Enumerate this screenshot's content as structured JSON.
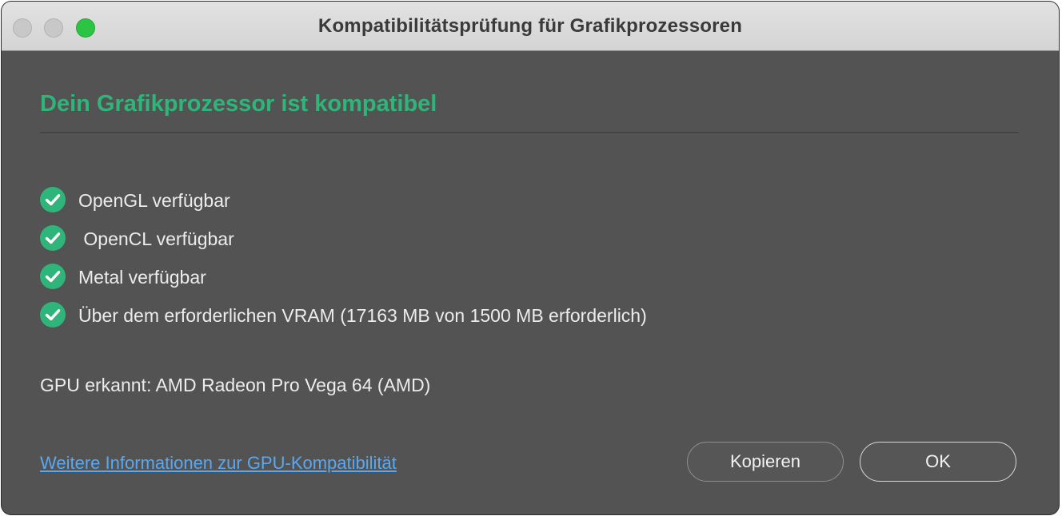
{
  "window": {
    "title": "Kompatibilitätsprüfung für Grafikprozessoren",
    "controls": {
      "close": "close-button",
      "minimize": "minimize-button",
      "zoom": "zoom-button"
    }
  },
  "result": {
    "heading": "Dein Grafikprozessor ist kompatibel",
    "accent_color": "#2fb57a"
  },
  "checks": [
    {
      "icon": "check-circle-icon",
      "label": "OpenGL verfügbar"
    },
    {
      "icon": "check-circle-icon",
      "label": " OpenCL verfügbar"
    },
    {
      "icon": "check-circle-icon",
      "label": "Metal verfügbar"
    },
    {
      "icon": "check-circle-icon",
      "label": "Über dem erforderlichen VRAM (17163 MB von 1500 MB erforderlich)"
    }
  ],
  "gpu": {
    "detected_text": "GPU erkannt: AMD Radeon Pro Vega 64 (AMD)"
  },
  "footer": {
    "link_text": "Weitere Informationen zur GPU-Kompatibilität",
    "copy_button": "Kopieren",
    "ok_button": "OK"
  }
}
